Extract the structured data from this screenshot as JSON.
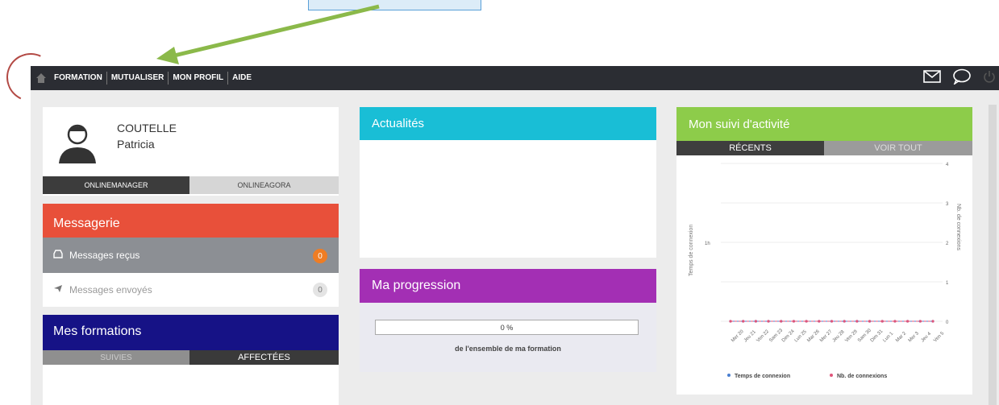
{
  "nav": {
    "items": [
      "FORMATION",
      "MUTUALISER",
      "MON PROFIL",
      "AIDE"
    ]
  },
  "profile": {
    "last_name": "COUTELLE",
    "first_name": "Patricia",
    "tab_manager": "ONLINEMANAGER",
    "tab_agora": "ONLINEAGORA"
  },
  "messagerie": {
    "title": "Messagerie",
    "received_label": "Messages reçus",
    "received_count": "0",
    "sent_label": "Messages envoyés",
    "sent_count": "0"
  },
  "formations": {
    "title": "Mes formations",
    "tab_suivies": "SUIVIES",
    "tab_affectees": "AFFECTÉES"
  },
  "actualites": {
    "title": "Actualités"
  },
  "progression": {
    "title": "Ma progression",
    "percent": "0 %",
    "caption": "de l'ensemble de ma formation"
  },
  "suivi": {
    "title": "Mon suivi d'activité",
    "tab_recents": "RÉCENTS",
    "tab_voir_tout": "VOIR TOUT",
    "legend_time": "Temps de connexion",
    "legend_count": "Nb. de connexions",
    "y_left_label": "Temps de connexion",
    "y_right_label": "Nb. de connexions"
  },
  "colors": {
    "nav_bg": "#2b2d33",
    "messagerie": "#e8503a",
    "formations": "#161286",
    "actualites": "#19bed6",
    "progression": "#a32fb4",
    "suivi": "#8dcc4a"
  },
  "chart_data": {
    "type": "line",
    "x": [
      "Mer 20",
      "Jeu 21",
      "Ven 22",
      "Sam 23",
      "Dim 24",
      "Lun 25",
      "Mar 26",
      "Mer 27",
      "Jeu 28",
      "Ven 29",
      "Sam 30",
      "Dim 31",
      "Lun 1",
      "Mar 2",
      "Mer 3",
      "Jeu 4",
      "Ven 5"
    ],
    "series": [
      {
        "name": "Temps de connexion",
        "values": [
          0,
          0,
          0,
          0,
          0,
          0,
          0,
          0,
          0,
          0,
          0,
          0,
          0,
          0,
          0,
          0,
          0
        ]
      },
      {
        "name": "Nb. de connexions",
        "values": [
          0,
          0,
          0,
          0,
          0,
          0,
          0,
          0,
          0,
          0,
          0,
          0,
          0,
          0,
          0,
          0,
          0
        ]
      }
    ],
    "y_right_ticks": [
      "0",
      "1",
      "2",
      "3",
      "4"
    ],
    "y_left_ticks": [
      "1h"
    ],
    "legend": "bottom"
  }
}
